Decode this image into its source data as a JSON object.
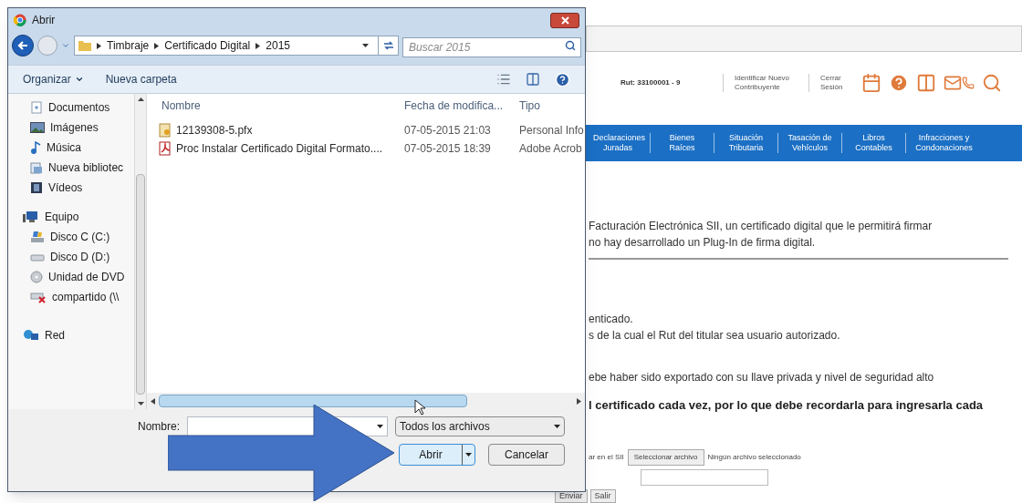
{
  "page": {
    "header": {
      "rut": "Rut: 33100001 - 9",
      "links": [
        "Identificar Nuevo Contribuyente",
        "Cerrar Sesión"
      ]
    },
    "nav": [
      "Declaraciones Juradas",
      "Bienes Raíces",
      "Situación Tributaria",
      "Tasación de Vehículos",
      "Libros Contables",
      "Infracciones y Condonaciones"
    ],
    "paragraphs": [
      {
        "lines": [
          "Facturación Electrónica SII, un certificado digital que le permitirá firmar",
          "no hay desarrollado un Plug-In de firma digital."
        ],
        "bold": false,
        "rule": true
      },
      {
        "lines": [
          "enticado.",
          "s de la cual el Rut del titular sea usuario autorizado."
        ],
        "bold": false,
        "rule": false
      },
      {
        "lines": [
          "ebe haber sido exportado con su llave privada y nivel de seguridad alto"
        ],
        "bold": false,
        "rule": false
      },
      {
        "lines": [
          "l certificado cada vez, por lo que debe recordarla para ingresarla cada"
        ],
        "bold": true,
        "rule": false
      }
    ],
    "upload": {
      "label": "ar en el SII",
      "button": "Seleccionar archivo",
      "status": "Ningún archivo seleccionado"
    },
    "buttons": [
      "Enviar",
      "Salir"
    ]
  },
  "dialog": {
    "title": "Abrir",
    "breadcrumb": [
      "Timbraje",
      "Certificado Digital",
      "2015"
    ],
    "search": {
      "placeholder": "Buscar 2015"
    },
    "toolbar": [
      {
        "label": "Organizar",
        "kind": "menu"
      },
      {
        "label": "Nueva carpeta",
        "kind": "button"
      }
    ],
    "sidebar": {
      "libraries": [
        {
          "label": "Documentos",
          "kind": "documents"
        },
        {
          "label": "Imágenes",
          "kind": "images"
        },
        {
          "label": "Música",
          "kind": "music"
        },
        {
          "label": "Nueva bibliotec",
          "kind": "library"
        },
        {
          "label": "Vídeos",
          "kind": "videos"
        }
      ],
      "computer": {
        "label": "Equipo",
        "children": [
          {
            "label": "Disco C (C:)",
            "kind": "system-disk"
          },
          {
            "label": "Disco D (D:)",
            "kind": "disk"
          },
          {
            "label": "Unidad de DVD",
            "kind": "dvd"
          },
          {
            "label": "compartido (\\\\",
            "kind": "share"
          }
        ]
      },
      "network": {
        "label": "Red"
      }
    },
    "columns": [
      "Nombre",
      "Fecha de modifica...",
      "Tipo"
    ],
    "files": [
      {
        "name": "12139308-5.pfx",
        "date": "07-05-2015 21:03",
        "type": "Personal Info",
        "kind": "certificate"
      },
      {
        "name": "Proc Instalar Certificado Digital Formato....",
        "date": "07-05-2015 18:39",
        "type": "Adobe Acrob",
        "kind": "pdf"
      }
    ],
    "footer": {
      "name_label": "Nombre:",
      "filter": "Todos los archivos",
      "open": "Abrir",
      "cancel": "Cancelar"
    }
  }
}
